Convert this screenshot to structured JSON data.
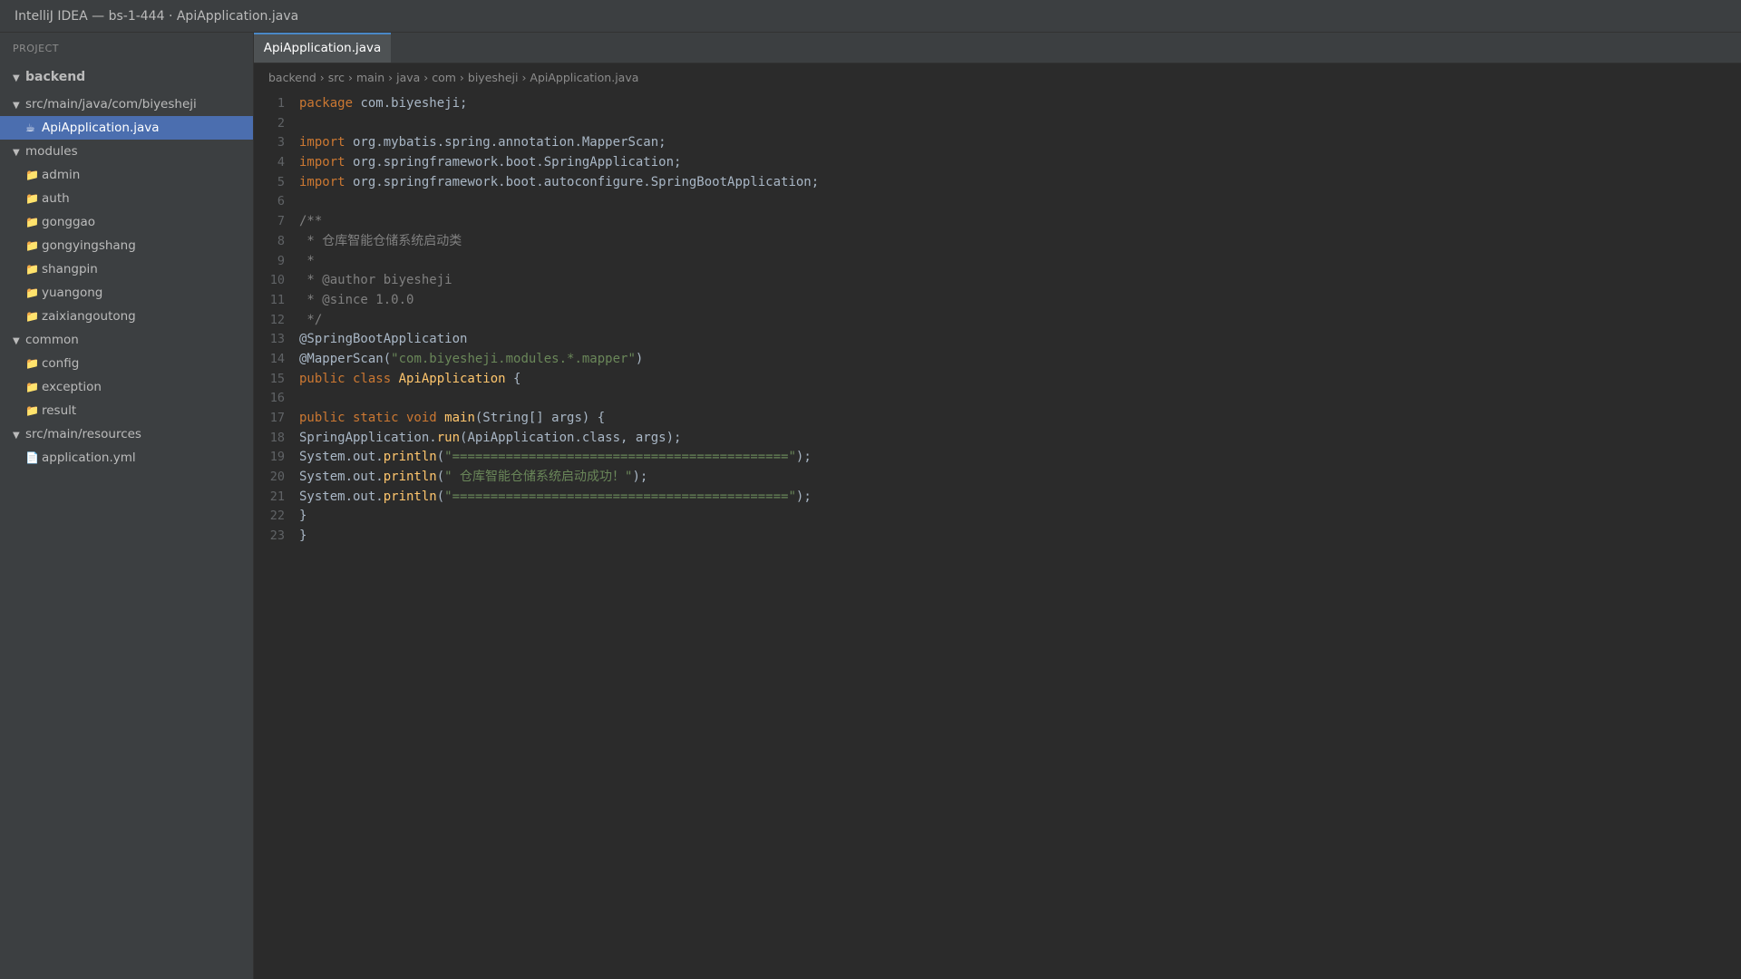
{
  "window": {
    "title": "IntelliJ IDEA — bs-1-444 · ApiApplication.java"
  },
  "sidebar": {
    "header": "PROJECT",
    "root": "backend",
    "items": [
      {
        "label": "src/main/java/com/biyesheji",
        "type": "folder-open"
      },
      {
        "label": "ApiApplication.java",
        "type": "java-file",
        "selected": true
      },
      {
        "label": "modules",
        "type": "folder-open"
      },
      {
        "label": "admin",
        "type": "folder"
      },
      {
        "label": "auth",
        "type": "folder"
      },
      {
        "label": "gonggao",
        "type": "folder"
      },
      {
        "label": "gongyingshang",
        "type": "folder"
      },
      {
        "label": "shangpin",
        "type": "folder"
      },
      {
        "label": "yuangong",
        "type": "folder"
      },
      {
        "label": "zaixiangoutong",
        "type": "folder"
      },
      {
        "label": "common",
        "type": "folder-open"
      },
      {
        "label": "config",
        "type": "folder"
      },
      {
        "label": "exception",
        "type": "folder"
      },
      {
        "label": "result",
        "type": "folder"
      },
      {
        "label": "src/main/resources",
        "type": "folder-open"
      },
      {
        "label": "application.yml",
        "type": "file"
      }
    ]
  },
  "editor": {
    "tab": "ApiApplication.java",
    "breadcrumb": "backend › src › main › java › com › biyesheji › ApiApplication.java",
    "lines": [
      [
        [
          "k",
          "package"
        ],
        [
          "t",
          " com.biyesheji;"
        ]
      ],
      [],
      [
        [
          "k",
          "import"
        ],
        [
          "t",
          " org.mybatis.spring.annotation.MapperScan;"
        ]
      ],
      [
        [
          "k",
          "import"
        ],
        [
          "t",
          " org.springframework.boot.SpringApplication;"
        ]
      ],
      [
        [
          "k",
          "import"
        ],
        [
          "t",
          " org.springframework.boot.autoconfigure.SpringBootApplication;"
        ]
      ],
      [],
      [
        [
          "c",
          "/**"
        ]
      ],
      [
        [
          "c",
          " * 仓库智能仓储系统启动类"
        ]
      ],
      [
        [
          "c",
          " *"
        ]
      ],
      [
        [
          "c",
          " * @author biyesheji"
        ]
      ],
      [
        [
          "c",
          " * @since 1.0.0"
        ]
      ],
      [
        [
          "c",
          " */"
        ]
      ],
      [
        [
          "t",
          "@SpringBootApplication"
        ]
      ],
      [
        [
          "t",
          "@MapperScan("
        ],
        [
          "s",
          "\"com.biyesheji.modules.*.mapper\""
        ],
        [
          "t",
          ")"
        ]
      ],
      [
        [
          "k",
          "public class "
        ],
        [
          "f",
          "ApiApplication"
        ],
        [
          "t",
          " {"
        ]
      ],
      [],
      [
        [
          "k",
          "public static void "
        ],
        [
          "f",
          "main"
        ],
        [
          "t",
          "(String[] args) {"
        ]
      ],
      [
        [
          "t",
          "SpringApplication."
        ],
        [
          "f",
          "run"
        ],
        [
          "t",
          "(ApiApplication.class, args);"
        ]
      ],
      [
        [
          "t",
          "System.out."
        ],
        [
          "f",
          "println"
        ],
        [
          "t",
          "("
        ],
        [
          "s",
          "\"============================================\""
        ],
        [
          "t",
          ");"
        ]
      ],
      [
        [
          "t",
          "System.out."
        ],
        [
          "f",
          "println"
        ],
        [
          "t",
          "("
        ],
        [
          "s",
          "\" 仓库智能仓储系统启动成功！\""
        ],
        [
          "t",
          ");"
        ]
      ],
      [
        [
          "t",
          "System.out."
        ],
        [
          "f",
          "println"
        ],
        [
          "t",
          "("
        ],
        [
          "s",
          "\"============================================\""
        ],
        [
          "t",
          ");"
        ]
      ],
      [
        [
          "t",
          "}"
        ]
      ],
      [
        [
          "t",
          "}"
        ]
      ]
    ]
  }
}
